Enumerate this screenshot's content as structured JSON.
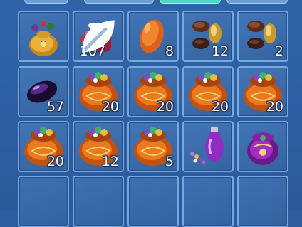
{
  "inventory": {
    "slots": [
      {
        "item": "golden-pouch-icon",
        "qty": null
      },
      {
        "item": "red-jar-icon",
        "qty": "107",
        "badge": "leaf-icon"
      },
      {
        "item": "amber-egg-icon",
        "qty": "8"
      },
      {
        "item": "seeds-icon",
        "qty": "12"
      },
      {
        "item": "seeds-icon",
        "qty": "2"
      },
      {
        "item": "purple-gem-icon",
        "qty": "57"
      },
      {
        "item": "orange-treasure-bag-icon",
        "qty": "20"
      },
      {
        "item": "orange-treasure-bag-icon",
        "qty": "20"
      },
      {
        "item": "orange-treasure-bag-icon",
        "qty": "20"
      },
      {
        "item": "orange-treasure-bag-icon",
        "qty": "20"
      },
      {
        "item": "orange-treasure-bag-icon",
        "qty": "20"
      },
      {
        "item": "orange-treasure-bag-icon",
        "qty": "12"
      },
      {
        "item": "orange-treasure-bag-icon",
        "qty": "5"
      },
      {
        "item": "potion-bottle-icon",
        "qty": null
      },
      {
        "item": "purple-pouch-icon",
        "qty": null
      },
      {
        "item": null,
        "qty": null
      },
      {
        "item": null,
        "qty": null
      },
      {
        "item": null,
        "qty": null
      },
      {
        "item": null,
        "qty": null
      },
      {
        "item": null,
        "qty": null
      }
    ]
  },
  "colors": {
    "background": "#2c5c9e",
    "slot_border": "#77a8df",
    "active_tab": "#4cd6c4"
  }
}
